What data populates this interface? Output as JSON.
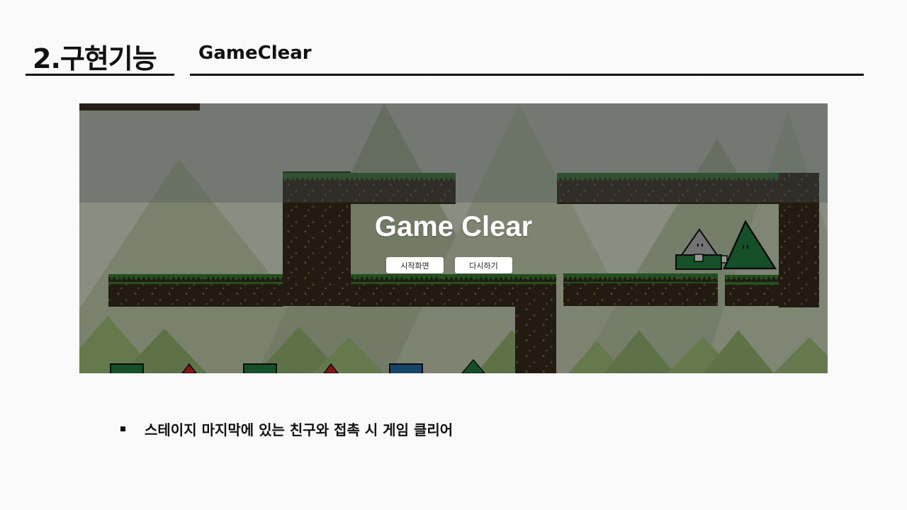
{
  "header": {
    "section_title": "2.구현기능",
    "subtitle": "GameClear"
  },
  "game": {
    "overlay_title": "Game Clear",
    "buttons": {
      "start_screen": "시작화면",
      "retry": "다시하기"
    },
    "colors": {
      "sky_tint": "#656b6b",
      "mountain": "#8a9a78",
      "dirt": "#2d2518",
      "grass": "#2e6b2a",
      "friend_green": "#1d6b37",
      "player_gray": "#9a9a9a",
      "red_triangle": "#b01e1e",
      "blue_square": "#1f5c8a"
    }
  },
  "description": {
    "bullet_text": "스테이지 마지막에 있는 친구와 접촉 시 게임 클리어"
  }
}
